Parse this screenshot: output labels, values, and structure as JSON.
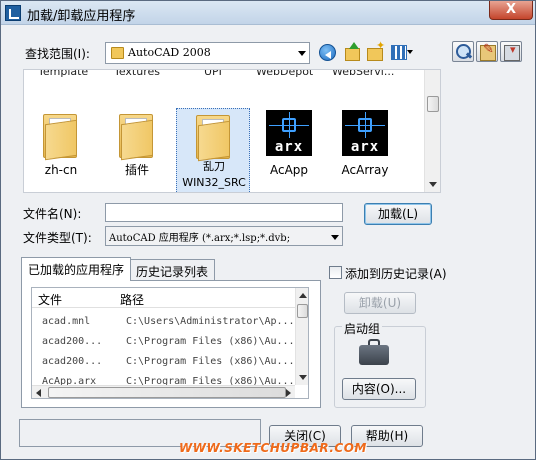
{
  "window": {
    "title": "加载/卸载应用程序",
    "close_label": "X"
  },
  "lookin": {
    "label": "查找范围(I):",
    "value": "AutoCAD 2008"
  },
  "toolbar_icons": [
    "back-icon",
    "up-folder-icon",
    "new-folder-icon",
    "views-icon",
    "find-icon",
    "search-web-icon",
    "tools-icon"
  ],
  "file_list": {
    "cut_off_row": [
      "Template",
      "Textures",
      "UPI",
      "WebDepot",
      "WebServi..."
    ],
    "items": [
      {
        "label": "zh-cn",
        "type": "folder"
      },
      {
        "label": "插件",
        "type": "folder"
      },
      {
        "label": "乱刀\nWIN32_SRC",
        "type": "folder",
        "selected": true
      },
      {
        "label": "AcApp",
        "type": "arx",
        "badge": "arx"
      },
      {
        "label": "AcArray",
        "type": "arx",
        "badge": "arx"
      }
    ]
  },
  "filename": {
    "label": "文件名(N):",
    "value": ""
  },
  "filetype": {
    "label": "文件类型(T):",
    "value": "AutoCAD 应用程序 (*.arx;*.lsp;*.dvb;"
  },
  "buttons": {
    "load": "加载(L)",
    "unload": "卸载(U)",
    "contents": "内容(O)...",
    "close": "关闭(C)",
    "help": "帮助(H)"
  },
  "tabs": [
    {
      "label": "已加载的应用程序",
      "active": true
    },
    {
      "label": "历史记录列表",
      "active": false
    }
  ],
  "loaded_apps": {
    "columns": [
      "文件",
      "路径"
    ],
    "rows": [
      {
        "file": "acad.mnl",
        "path": "C:\\Users\\Administrator\\Ap..."
      },
      {
        "file": "acad200...",
        "path": "C:\\Program Files (x86)\\Au..."
      },
      {
        "file": "acad200...",
        "path": "C:\\Program Files (x86)\\Au..."
      },
      {
        "file": "AcApp.arx",
        "path": "C:\\Program Files (x86)\\Au..."
      }
    ]
  },
  "add_history": {
    "label": "添加到历史记录(A)",
    "checked": false
  },
  "startup_group": {
    "label": "启动组"
  },
  "watermark": "WWW.SKETCHUPBAR.COM"
}
